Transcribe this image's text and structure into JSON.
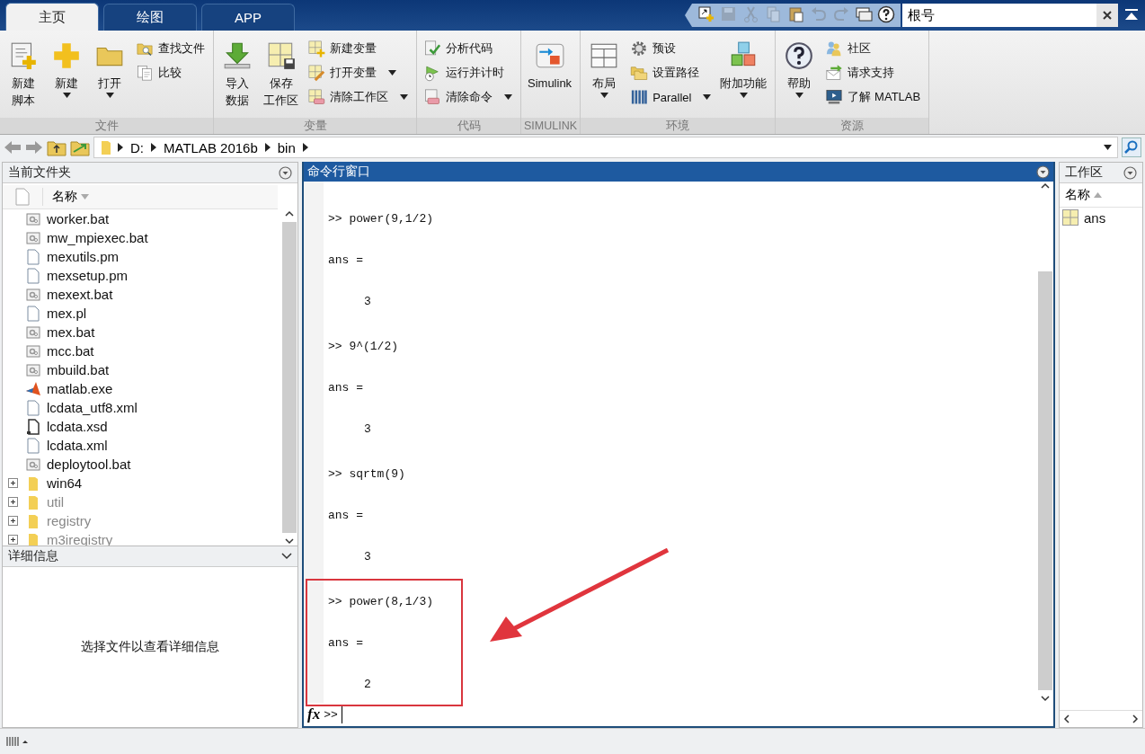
{
  "tabs": [
    {
      "label": "主页",
      "selected": true
    },
    {
      "label": "绘图",
      "selected": false
    },
    {
      "label": "APP",
      "selected": false
    }
  ],
  "quick_access": [
    {
      "disabled": false
    },
    {
      "disabled": true
    },
    {
      "disabled": true
    },
    {
      "disabled": true
    },
    {
      "disabled": false
    },
    {
      "disabled": true
    },
    {
      "disabled": true
    },
    {
      "disabled": false
    },
    {
      "disabled": false
    }
  ],
  "search": {
    "value": "根号"
  },
  "ribbon": {
    "groups": [
      {
        "label": "文件",
        "items": [
          {
            "kind": "large",
            "lines": [
              "新建",
              "脚本"
            ],
            "dropdown": false
          },
          {
            "kind": "large",
            "lines": [
              "新建"
            ],
            "dropdown": true
          },
          {
            "kind": "large",
            "lines": [
              "打开"
            ],
            "dropdown": true
          },
          {
            "kind": "small",
            "lines": [
              "查找文件"
            ],
            "dropdown": false
          },
          {
            "kind": "small",
            "lines": [
              "比较"
            ],
            "dropdown": false
          }
        ]
      },
      {
        "label": "变量",
        "items": [
          {
            "kind": "large",
            "lines": [
              "导入",
              "数据"
            ],
            "dropdown": false
          },
          {
            "kind": "large",
            "lines": [
              "保存",
              "工作区"
            ],
            "dropdown": false
          },
          {
            "kind": "small",
            "lines": [
              "新建变量"
            ],
            "dropdown": false
          },
          {
            "kind": "small",
            "lines": [
              "打开变量"
            ],
            "dropdown": true
          },
          {
            "kind": "small",
            "lines": [
              "清除工作区"
            ],
            "dropdown": true
          }
        ]
      },
      {
        "label": "代码",
        "items": [
          {
            "kind": "small",
            "lines": [
              "分析代码"
            ],
            "dropdown": false
          },
          {
            "kind": "small",
            "lines": [
              "运行并计时"
            ],
            "dropdown": false
          },
          {
            "kind": "small",
            "lines": [
              "清除命令"
            ],
            "dropdown": true
          }
        ]
      },
      {
        "label": "SIMULINK",
        "items": [
          {
            "kind": "large",
            "lines": [
              "Simulink"
            ],
            "dropdown": false
          }
        ]
      },
      {
        "label": "环境",
        "items": [
          {
            "kind": "large",
            "lines": [
              "布局"
            ],
            "dropdown": true
          },
          {
            "kind": "small",
            "lines": [
              "预设"
            ],
            "dropdown": false
          },
          {
            "kind": "small",
            "lines": [
              "设置路径"
            ],
            "dropdown": false
          },
          {
            "kind": "small",
            "lines": [
              "Parallel"
            ],
            "dropdown": true
          },
          {
            "kind": "large",
            "lines": [
              "附加功能"
            ],
            "dropdown": true
          }
        ]
      },
      {
        "label": "资源",
        "items": [
          {
            "kind": "large",
            "lines": [
              "帮助"
            ],
            "dropdown": true
          },
          {
            "kind": "small",
            "lines": [
              "社区"
            ],
            "dropdown": false
          },
          {
            "kind": "small",
            "lines": [
              "请求支持"
            ],
            "dropdown": false
          },
          {
            "kind": "small",
            "lines": [
              "了解 MATLAB"
            ],
            "dropdown": false
          }
        ]
      }
    ]
  },
  "address_bar": {
    "path": [
      "D:",
      "MATLAB 2016b",
      "bin"
    ]
  },
  "current_folder": {
    "title": "当前文件夹",
    "column": "名称",
    "files": [
      {
        "name": "worker.bat",
        "kind": "script"
      },
      {
        "name": "mw_mpiexec.bat",
        "kind": "script"
      },
      {
        "name": "mexutils.pm",
        "kind": "file"
      },
      {
        "name": "mexsetup.pm",
        "kind": "file"
      },
      {
        "name": "mexext.bat",
        "kind": "script"
      },
      {
        "name": "mex.pl",
        "kind": "file"
      },
      {
        "name": "mex.bat",
        "kind": "script"
      },
      {
        "name": "mcc.bat",
        "kind": "script"
      },
      {
        "name": "mbuild.bat",
        "kind": "script"
      },
      {
        "name": "matlab.exe",
        "kind": "exe"
      },
      {
        "name": "lcdata_utf8.xml",
        "kind": "file"
      },
      {
        "name": "lcdata.xsd",
        "kind": "schema"
      },
      {
        "name": "lcdata.xml",
        "kind": "file"
      },
      {
        "name": "deploytool.bat",
        "kind": "script"
      },
      {
        "name": "win64",
        "kind": "folder",
        "expanded": false,
        "disabled": false
      },
      {
        "name": "util",
        "kind": "folder",
        "expanded": false,
        "disabled": true
      },
      {
        "name": "registry",
        "kind": "folder",
        "expanded": false,
        "disabled": true
      },
      {
        "name": "m3iregistry",
        "kind": "folder",
        "expanded": false,
        "disabled": true
      }
    ]
  },
  "details": {
    "title": "详细信息",
    "message": "选择文件以查看详细信息"
  },
  "command_window": {
    "title": "命令行窗口",
    "blocks": [
      {
        "highlighted": false,
        "lines": [
          {
            "kind": "input",
            "text": ">> power(9,1/2)"
          },
          {
            "kind": "output",
            "text": "ans ="
          },
          {
            "kind": "value",
            "text": "3"
          }
        ]
      },
      {
        "highlighted": false,
        "lines": [
          {
            "kind": "input",
            "text": ">> 9^(1/2)"
          },
          {
            "kind": "output",
            "text": "ans ="
          },
          {
            "kind": "value",
            "text": "3"
          }
        ]
      },
      {
        "highlighted": false,
        "lines": [
          {
            "kind": "input",
            "text": ">> sqrtm(9)"
          },
          {
            "kind": "output",
            "text": "ans ="
          },
          {
            "kind": "value",
            "text": "3"
          }
        ]
      },
      {
        "highlighted": true,
        "lines": [
          {
            "kind": "input",
            "text": ">> power(8,1/3)"
          },
          {
            "kind": "output",
            "text": "ans ="
          },
          {
            "kind": "value",
            "text": "2"
          }
        ]
      }
    ],
    "function_button": "fx",
    "prompt": ">>"
  },
  "workspace": {
    "title": "工作区",
    "column": "名称",
    "variables": [
      {
        "name": "ans"
      }
    ]
  }
}
